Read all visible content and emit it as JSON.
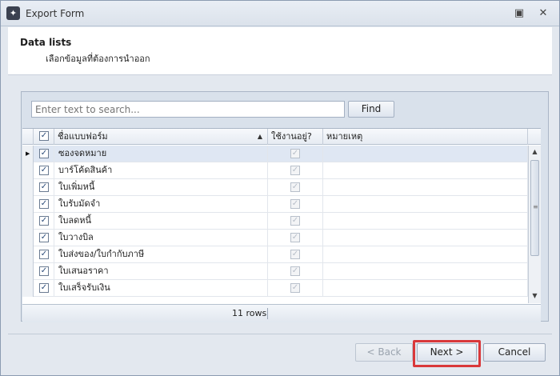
{
  "window": {
    "title": "Export Form"
  },
  "header": {
    "title": "Data lists",
    "subtitle": "เลือกข้อมูลที่ต้องการนำออก"
  },
  "search": {
    "placeholder": "Enter text to search...",
    "find_label": "Find"
  },
  "grid": {
    "columns": [
      "ชื่อแบบฟอร์ม",
      "ใช้งานอยู่?",
      "หมายเหตุ"
    ],
    "rows": [
      {
        "name": "ซองจดหมาย",
        "checked": true,
        "active": true,
        "note": ""
      },
      {
        "name": "บาร์โค้ดสินค้า",
        "checked": true,
        "active": true,
        "note": ""
      },
      {
        "name": "ใบเพิ่มหนี้",
        "checked": true,
        "active": true,
        "note": ""
      },
      {
        "name": "ใบรับมัดจำ",
        "checked": true,
        "active": true,
        "note": ""
      },
      {
        "name": "ใบลดหนี้",
        "checked": true,
        "active": true,
        "note": ""
      },
      {
        "name": "ใบวางบิล",
        "checked": true,
        "active": true,
        "note": ""
      },
      {
        "name": "ใบส่งของ/ใบกำกับภาษี",
        "checked": true,
        "active": true,
        "note": ""
      },
      {
        "name": "ใบเสนอราคา",
        "checked": true,
        "active": true,
        "note": ""
      },
      {
        "name": "ใบเสร็จรับเงิน",
        "checked": true,
        "active": true,
        "note": ""
      }
    ],
    "footer_count": "11 rows"
  },
  "buttons": {
    "back": "< Back",
    "next": "Next >",
    "cancel": "Cancel"
  },
  "icons": {
    "app": "app-logo-icon",
    "restore": "restore-icon",
    "close": "close-icon",
    "sort": "sort-ascending-icon",
    "row_pointer": "row-pointer-icon"
  },
  "colors": {
    "highlight": "#d9383a",
    "selected_row": "#dfe7f3"
  }
}
